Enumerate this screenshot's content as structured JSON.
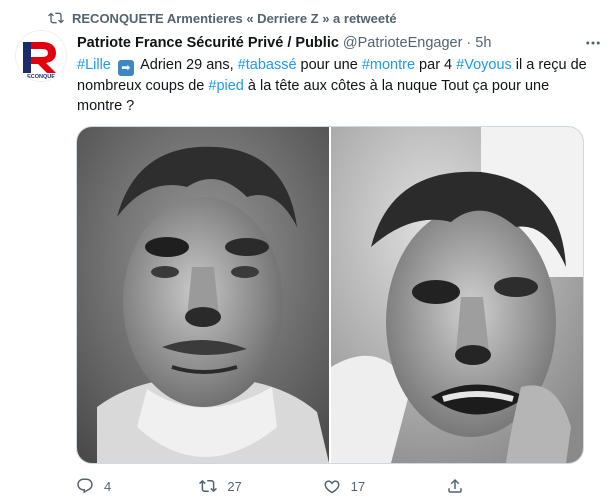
{
  "retweet": {
    "text": "RECONQUETE Armentieres « Derriere Z » a retweeté",
    "icon": "retweet-icon"
  },
  "author": {
    "name": "Patriote France Sécurité Privé / Public",
    "handle": "@PatrioteEngager",
    "separator": "·",
    "time": "5h",
    "avatar_text": "ECONQUE"
  },
  "tweet": {
    "segments": [
      {
        "text": "#Lille",
        "type": "hashtag"
      },
      {
        "text": " ",
        "type": "text"
      },
      {
        "text": "➡",
        "type": "emoji"
      },
      {
        "text": " Adrien  29 ans, ",
        "type": "text"
      },
      {
        "text": "#tabassé",
        "type": "hashtag"
      },
      {
        "text": " pour une ",
        "type": "text"
      },
      {
        "text": "#montre",
        "type": "hashtag"
      },
      {
        "text": " par 4 ",
        "type": "text"
      },
      {
        "text": "#Voyous",
        "type": "hashtag"
      },
      {
        "text": "  il a reçu de nombreux coups de ",
        "type": "text"
      },
      {
        "text": "#pied",
        "type": "hashtag"
      },
      {
        "text": "  à la tête  aux côtes  à la nuque Tout ça pour une montre ?",
        "type": "text"
      }
    ]
  },
  "actions": {
    "reply_count": "4",
    "retweet_count": "27",
    "like_count": "17"
  },
  "colors": {
    "link": "#1d9bf0",
    "text": "#0f1419",
    "secondary": "#536471",
    "brand_red": "#e1000f",
    "brand_blue": "#1b2b6b"
  }
}
